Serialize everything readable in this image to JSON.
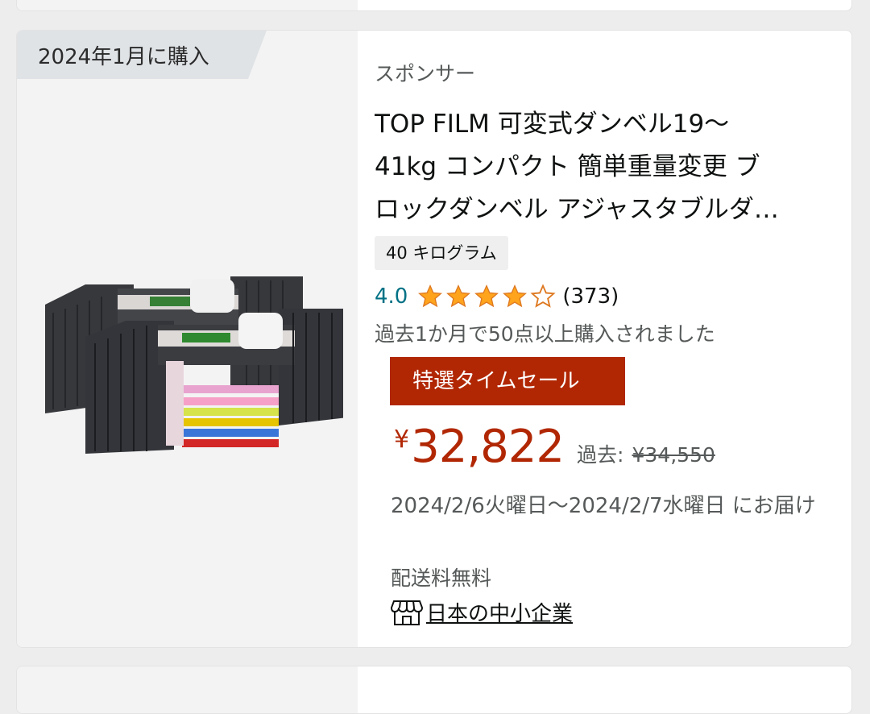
{
  "card": {
    "purchase_banner": "2024年1月に購入",
    "sponsored_label": "スポンサー",
    "title_lines": [
      "TOP FILM 可変式ダンベル19〜",
      "41kg コンパクト 簡単重量変更 ブ",
      "ロックダンベル アジャスタブルダ…"
    ],
    "size_option": "40 キログラム",
    "rating": {
      "value": "4.0",
      "stars_filled": 4,
      "stars_total": 5,
      "review_count": "(373)"
    },
    "bought_text": "過去1か月で50点以上購入されました",
    "deal_badge": "特選タイムセール",
    "price": {
      "currency": "¥",
      "amount": "32,822",
      "past_label": "過去:",
      "past_price": "¥34,550"
    },
    "delivery_text": "2024/2/6火曜日〜2024/2/7水曜日 にお届け",
    "shipping_text": "配送料無料",
    "seller_badge": {
      "icon": "storefront-icon",
      "label": "日本の中小企業"
    }
  },
  "colors": {
    "price": "#b12704",
    "deal_badge": "#b12704",
    "star": "#ffa41c",
    "rating_link": "#007185"
  }
}
